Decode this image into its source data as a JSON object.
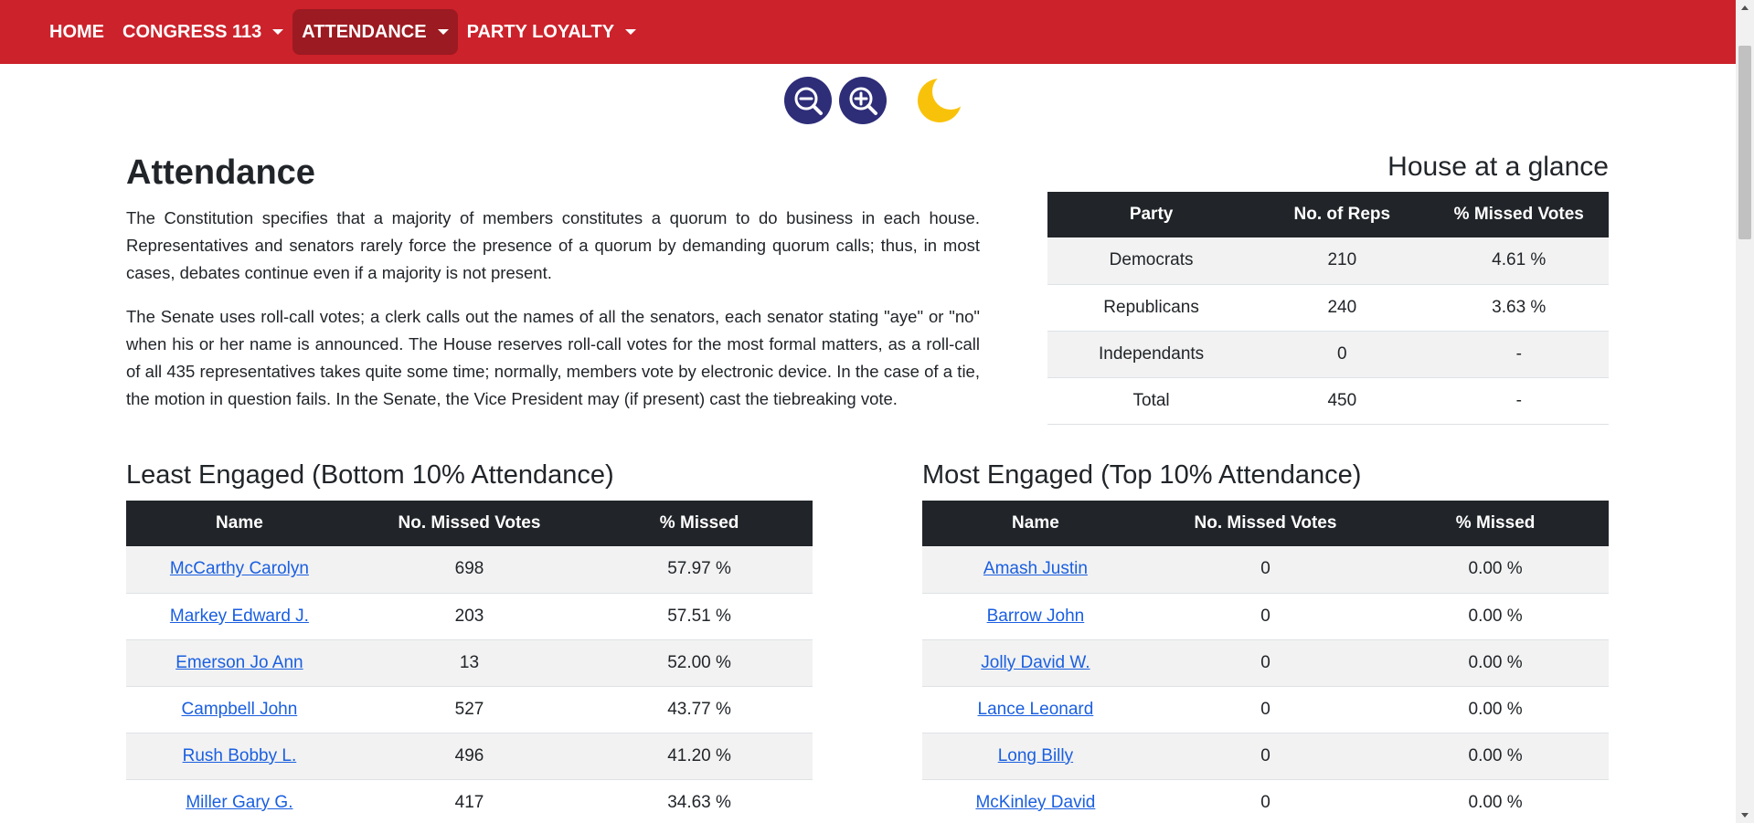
{
  "nav": {
    "home": "HOME",
    "congress": "CONGRESS 113",
    "attendance": "ATTENDANCE",
    "party_loyalty": "PARTY LOYALTY"
  },
  "controls": {
    "zoom_out_icon": "zoom-out-icon",
    "zoom_in_icon": "zoom-in-icon",
    "theme_icon": "moon-icon"
  },
  "colors": {
    "navbar": "#cc222b",
    "navbar_active": "#9c1a21",
    "zoom_button": "#2d2d78",
    "moon": "#f9c20a",
    "table_header": "#212529",
    "link": "#1a5fe0"
  },
  "page": {
    "title": "Attendance",
    "intro_1": "The Constitution specifies that a majority of members constitutes a quorum to do business in each house. Representatives and senators rarely force the presence of a quorum by demanding quorum calls; thus, in most cases, debates continue even if a majority is not present.",
    "intro_2": "The Senate uses roll-call votes; a clerk calls out the names of all the senators, each senator stating \"aye\" or \"no\" when his or her name is announced. The House reserves roll-call votes for the most formal matters, as a roll-call of all 435 representatives takes quite some time; normally, members vote by electronic device. In the case of a tie, the motion in question fails. In the Senate, the Vice President may (if present) cast the tiebreaking vote."
  },
  "glance": {
    "title": "House at a glance",
    "headers": [
      "Party",
      "No. of Reps",
      "% Missed Votes"
    ],
    "rows": [
      [
        "Democrats",
        "210",
        "4.61 %"
      ],
      [
        "Republicans",
        "240",
        "3.63 %"
      ],
      [
        "Independants",
        "0",
        "-"
      ],
      [
        "Total",
        "450",
        "-"
      ]
    ]
  },
  "least": {
    "title": "Least Engaged (Bottom 10% Attendance)",
    "headers": [
      "Name",
      "No. Missed Votes",
      "% Missed"
    ],
    "rows": [
      [
        "McCarthy Carolyn",
        "698",
        "57.97 %"
      ],
      [
        "Markey Edward J.",
        "203",
        "57.51 %"
      ],
      [
        "Emerson Jo Ann",
        "13",
        "52.00 %"
      ],
      [
        "Campbell John",
        "527",
        "43.77 %"
      ],
      [
        "Rush Bobby L.",
        "496",
        "41.20 %"
      ],
      [
        "Miller Gary G.",
        "417",
        "34.63 %"
      ]
    ]
  },
  "most": {
    "title": "Most Engaged (Top 10% Attendance)",
    "headers": [
      "Name",
      "No. Missed Votes",
      "% Missed"
    ],
    "rows": [
      [
        "Amash Justin",
        "0",
        "0.00 %"
      ],
      [
        "Barrow John",
        "0",
        "0.00 %"
      ],
      [
        "Jolly David W.",
        "0",
        "0.00 %"
      ],
      [
        "Lance Leonard",
        "0",
        "0.00 %"
      ],
      [
        "Long Billy",
        "0",
        "0.00 %"
      ],
      [
        "McKinley David",
        "0",
        "0.00 %"
      ]
    ]
  }
}
